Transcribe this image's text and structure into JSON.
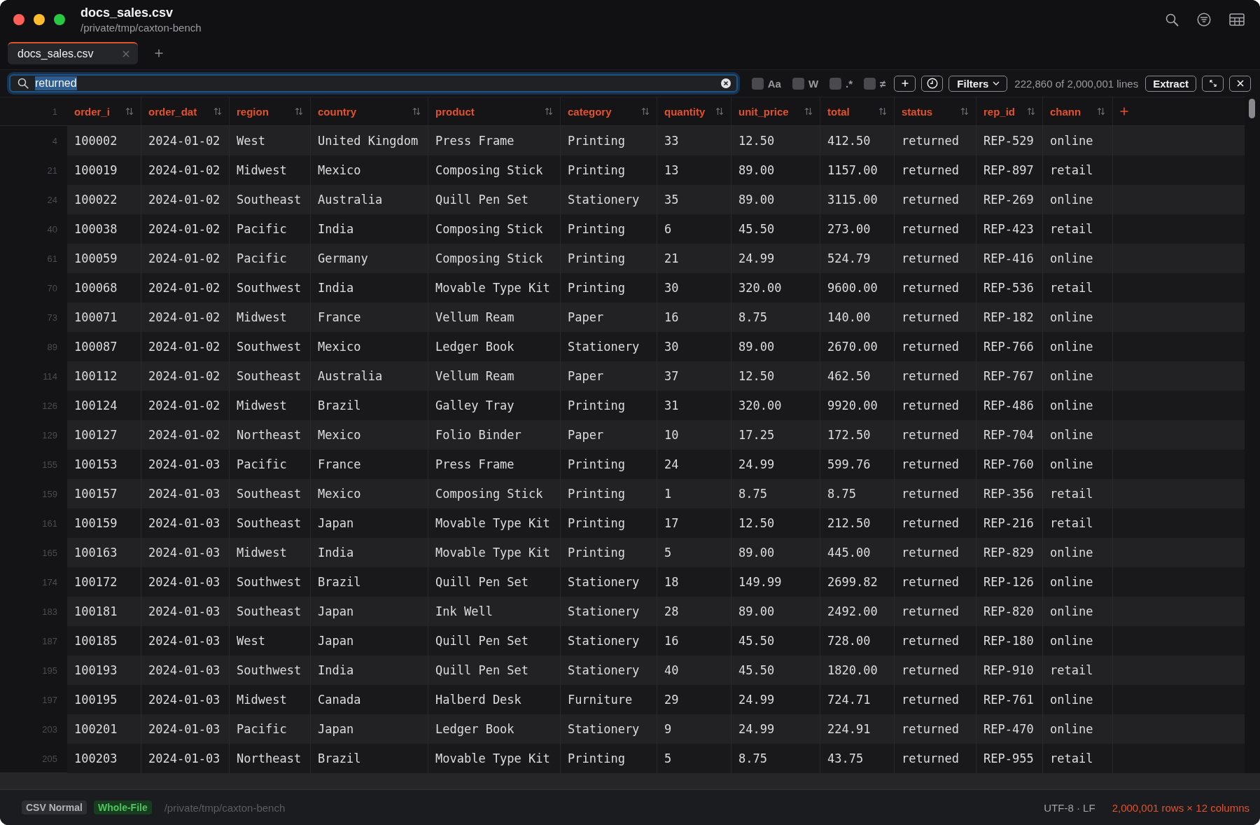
{
  "window": {
    "title": "docs_sales.csv",
    "subtitle": "/private/tmp/caxton-bench"
  },
  "tabs": [
    {
      "label": "docs_sales.csv",
      "selected": true
    }
  ],
  "search": {
    "value": "returned",
    "text_selected": true
  },
  "toggles": [
    {
      "label": "Aa",
      "checked": false
    },
    {
      "label": "W",
      "checked": false
    },
    {
      "label": ".*",
      "checked": false
    },
    {
      "label": "≠",
      "checked": false
    }
  ],
  "filters_button": "Filters",
  "match_count": "222,860 of 2,000,001 lines",
  "extract_button": "Extract",
  "table": {
    "header_line": "1",
    "columns": [
      {
        "label": "order_i"
      },
      {
        "label": "order_dat"
      },
      {
        "label": "region"
      },
      {
        "label": "country"
      },
      {
        "label": "product"
      },
      {
        "label": "category"
      },
      {
        "label": "quantity"
      },
      {
        "label": "unit_price"
      },
      {
        "label": "total"
      },
      {
        "label": "status"
      },
      {
        "label": "rep_id"
      },
      {
        "label": "chann"
      }
    ],
    "rows": [
      {
        "line": "4",
        "cells": [
          "100002",
          "2024-01-02",
          "West",
          "United Kingdom",
          "Press Frame",
          "Printing",
          "33",
          "12.50",
          "412.50",
          "returned",
          "REP-529",
          "online"
        ]
      },
      {
        "line": "21",
        "cells": [
          "100019",
          "2024-01-02",
          "Midwest",
          "Mexico",
          "Composing Stick",
          "Printing",
          "13",
          "89.00",
          "1157.00",
          "returned",
          "REP-897",
          "retail"
        ]
      },
      {
        "line": "24",
        "cells": [
          "100022",
          "2024-01-02",
          "Southeast",
          "Australia",
          "Quill Pen Set",
          "Stationery",
          "35",
          "89.00",
          "3115.00",
          "returned",
          "REP-269",
          "online"
        ]
      },
      {
        "line": "40",
        "cells": [
          "100038",
          "2024-01-02",
          "Pacific",
          "India",
          "Composing Stick",
          "Printing",
          "6",
          "45.50",
          "273.00",
          "returned",
          "REP-423",
          "retail"
        ]
      },
      {
        "line": "61",
        "cells": [
          "100059",
          "2024-01-02",
          "Pacific",
          "Germany",
          "Composing Stick",
          "Printing",
          "21",
          "24.99",
          "524.79",
          "returned",
          "REP-416",
          "online"
        ]
      },
      {
        "line": "70",
        "cells": [
          "100068",
          "2024-01-02",
          "Southwest",
          "India",
          "Movable Type Kit",
          "Printing",
          "30",
          "320.00",
          "9600.00",
          "returned",
          "REP-536",
          "retail"
        ]
      },
      {
        "line": "73",
        "cells": [
          "100071",
          "2024-01-02",
          "Midwest",
          "France",
          "Vellum Ream",
          "Paper",
          "16",
          "8.75",
          "140.00",
          "returned",
          "REP-182",
          "online"
        ]
      },
      {
        "line": "89",
        "cells": [
          "100087",
          "2024-01-02",
          "Southwest",
          "Mexico",
          "Ledger Book",
          "Stationery",
          "30",
          "89.00",
          "2670.00",
          "returned",
          "REP-766",
          "online"
        ]
      },
      {
        "line": "114",
        "cells": [
          "100112",
          "2024-01-02",
          "Southeast",
          "Australia",
          "Vellum Ream",
          "Paper",
          "37",
          "12.50",
          "462.50",
          "returned",
          "REP-767",
          "online"
        ]
      },
      {
        "line": "126",
        "cells": [
          "100124",
          "2024-01-02",
          "Midwest",
          "Brazil",
          "Galley Tray",
          "Printing",
          "31",
          "320.00",
          "9920.00",
          "returned",
          "REP-486",
          "online"
        ]
      },
      {
        "line": "129",
        "cells": [
          "100127",
          "2024-01-02",
          "Northeast",
          "Mexico",
          "Folio Binder",
          "Paper",
          "10",
          "17.25",
          "172.50",
          "returned",
          "REP-704",
          "online"
        ]
      },
      {
        "line": "155",
        "cells": [
          "100153",
          "2024-01-03",
          "Pacific",
          "France",
          "Press Frame",
          "Printing",
          "24",
          "24.99",
          "599.76",
          "returned",
          "REP-760",
          "online"
        ]
      },
      {
        "line": "159",
        "cells": [
          "100157",
          "2024-01-03",
          "Southeast",
          "Mexico",
          "Composing Stick",
          "Printing",
          "1",
          "8.75",
          "8.75",
          "returned",
          "REP-356",
          "retail"
        ]
      },
      {
        "line": "161",
        "cells": [
          "100159",
          "2024-01-03",
          "Southeast",
          "Japan",
          "Movable Type Kit",
          "Printing",
          "17",
          "12.50",
          "212.50",
          "returned",
          "REP-216",
          "retail"
        ]
      },
      {
        "line": "165",
        "cells": [
          "100163",
          "2024-01-03",
          "Midwest",
          "India",
          "Movable Type Kit",
          "Printing",
          "5",
          "89.00",
          "445.00",
          "returned",
          "REP-829",
          "online"
        ]
      },
      {
        "line": "174",
        "cells": [
          "100172",
          "2024-01-03",
          "Southwest",
          "Brazil",
          "Quill Pen Set",
          "Stationery",
          "18",
          "149.99",
          "2699.82",
          "returned",
          "REP-126",
          "online"
        ]
      },
      {
        "line": "183",
        "cells": [
          "100181",
          "2024-01-03",
          "Southeast",
          "Japan",
          "Ink Well",
          "Stationery",
          "28",
          "89.00",
          "2492.00",
          "returned",
          "REP-820",
          "online"
        ]
      },
      {
        "line": "187",
        "cells": [
          "100185",
          "2024-01-03",
          "West",
          "Japan",
          "Quill Pen Set",
          "Stationery",
          "16",
          "45.50",
          "728.00",
          "returned",
          "REP-180",
          "online"
        ]
      },
      {
        "line": "195",
        "cells": [
          "100193",
          "2024-01-03",
          "Southwest",
          "India",
          "Quill Pen Set",
          "Stationery",
          "40",
          "45.50",
          "1820.00",
          "returned",
          "REP-910",
          "retail"
        ]
      },
      {
        "line": "197",
        "cells": [
          "100195",
          "2024-01-03",
          "Midwest",
          "Canada",
          "Halberd Desk",
          "Furniture",
          "29",
          "24.99",
          "724.71",
          "returned",
          "REP-761",
          "online"
        ]
      },
      {
        "line": "203",
        "cells": [
          "100201",
          "2024-01-03",
          "Pacific",
          "Japan",
          "Ledger Book",
          "Stationery",
          "9",
          "24.99",
          "224.91",
          "returned",
          "REP-470",
          "online"
        ]
      },
      {
        "line": "205",
        "cells": [
          "100203",
          "2024-01-03",
          "Northeast",
          "Brazil",
          "Movable Type Kit",
          "Printing",
          "5",
          "8.75",
          "43.75",
          "returned",
          "REP-955",
          "retail"
        ]
      }
    ]
  },
  "status_bar": {
    "badges": [
      {
        "label": "CSV Normal",
        "kind": "neutral"
      },
      {
        "label": "Whole-File",
        "kind": "success"
      }
    ],
    "path": "/private/tmp/caxton-bench",
    "encoding": "UTF-8 · LF",
    "summary": "2,000,001 rows × 12 columns"
  }
}
